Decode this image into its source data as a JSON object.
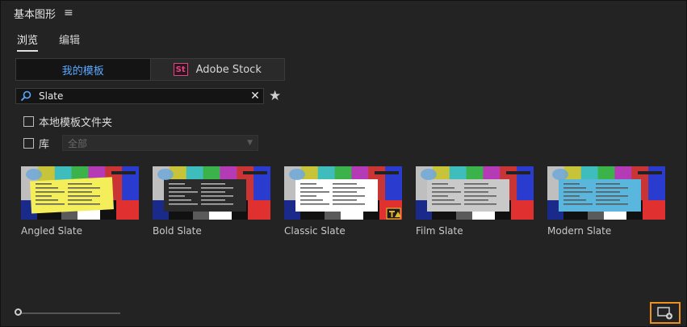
{
  "panel": {
    "title": "基本图形"
  },
  "tabs": [
    {
      "label": "浏览",
      "active": true
    },
    {
      "label": "编辑",
      "active": false
    }
  ],
  "source": {
    "my_templates": "我的模板",
    "adobe_stock": "Adobe Stock",
    "stock_logo": "St"
  },
  "search": {
    "value": "Slate"
  },
  "filters": {
    "local_folder": "本地模板文件夹",
    "library": "库",
    "library_select": "全部"
  },
  "templates": [
    {
      "label": "Angled Slate",
      "panel_color": "#f4ee5a"
    },
    {
      "label": "Bold Slate",
      "panel_color": "#2b2b2b"
    },
    {
      "label": "Classic Slate",
      "panel_color": "#ffffff"
    },
    {
      "label": "Film Slate",
      "panel_color": "#c9c9c9"
    },
    {
      "label": "Modern Slate",
      "panel_color": "#5ab6dc"
    }
  ],
  "colors": {
    "accent_blue": "#5aa8ff",
    "highlight_orange": "#f0901c"
  },
  "zoom": {
    "level": 0
  }
}
